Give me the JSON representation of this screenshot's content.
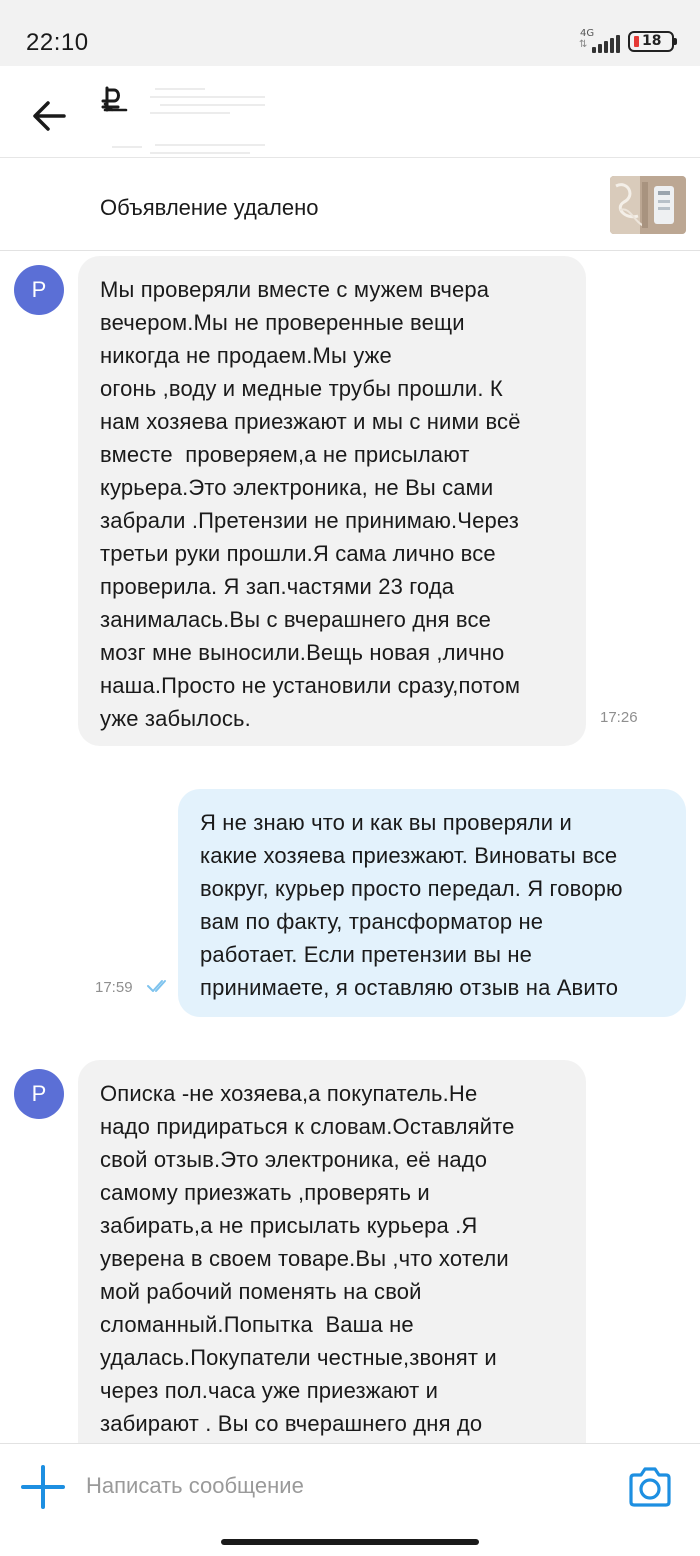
{
  "status_bar": {
    "time": "22:10",
    "network": "4G",
    "battery": "18",
    "battery_color": "#e53935"
  },
  "header": {
    "back_icon": "arrow-left-icon",
    "avatar_icon": "ruble-icon"
  },
  "listing": {
    "status_text": "Объявление удалено",
    "thumbnail_icon": "product-photo"
  },
  "messages": [
    {
      "direction": "incoming",
      "avatar_letter": "P",
      "text": "Мы проверяли вместе с мужем вчера\nвечером.Мы не проверенные вещи\nникогда не продаем.Мы уже\nогонь ,воду и медные трубы прошли. К\nнам хозяева приезжают и мы с ними всё\nвместе  проверяем,а не присылают\nкурьера.Это электроника, не Вы сами\nзабрали .Претензии не принимаю.Через\nтретьи руки прошли.Я сама лично все\nпроверила. Я зап.частями 23 года\nзанималась.Вы с вчерашнего дня все\nмозг мне выносили.Вещь новая ,лично\nнаша.Просто не установили сразу,потом\nуже забылось.",
      "time": "17:26"
    },
    {
      "direction": "outgoing",
      "text": "Я не знаю что и как вы проверяли и\nкакие хозяева приезжают. Виноваты все\nвокруг, курьер просто передал. Я говорю\nвам по факту, трансформатор не\nработает. Если претензии вы не\nпринимаете, я оставляю отзыв на Авито",
      "time": "17:59",
      "read_icon": "double-check-icon"
    },
    {
      "direction": "incoming",
      "avatar_letter": "P",
      "text": "Описка -не хозяева,а покупатель.Не\nнадо придираться к словам.Оставляйте\nсвой отзыв.Это электроника, её надо\nсамому приезжать ,проверять и\nзабирать,а не присылать курьера .Я\nуверена в своем товаре.Вы ,что хотели\nмой рабочий поменять на свой\nсломанный.Попытка  Ваша не\nудалась.Покупатели честные,звонят и\nчерез пол.часа уже приезжают и\nзабирают . Вы со вчерашнего дня до"
    }
  ],
  "composer": {
    "placeholder": "Написать сообщение",
    "plus_icon": "plus-icon",
    "camera_icon": "camera-icon",
    "accent_color": "#1d8fe1"
  },
  "colors": {
    "avatar": "#5b6fd6",
    "incoming_bubble": "#f2f2f2",
    "outgoing_bubble": "#e3f2fc",
    "read_ticks": "#7ec3ee"
  }
}
